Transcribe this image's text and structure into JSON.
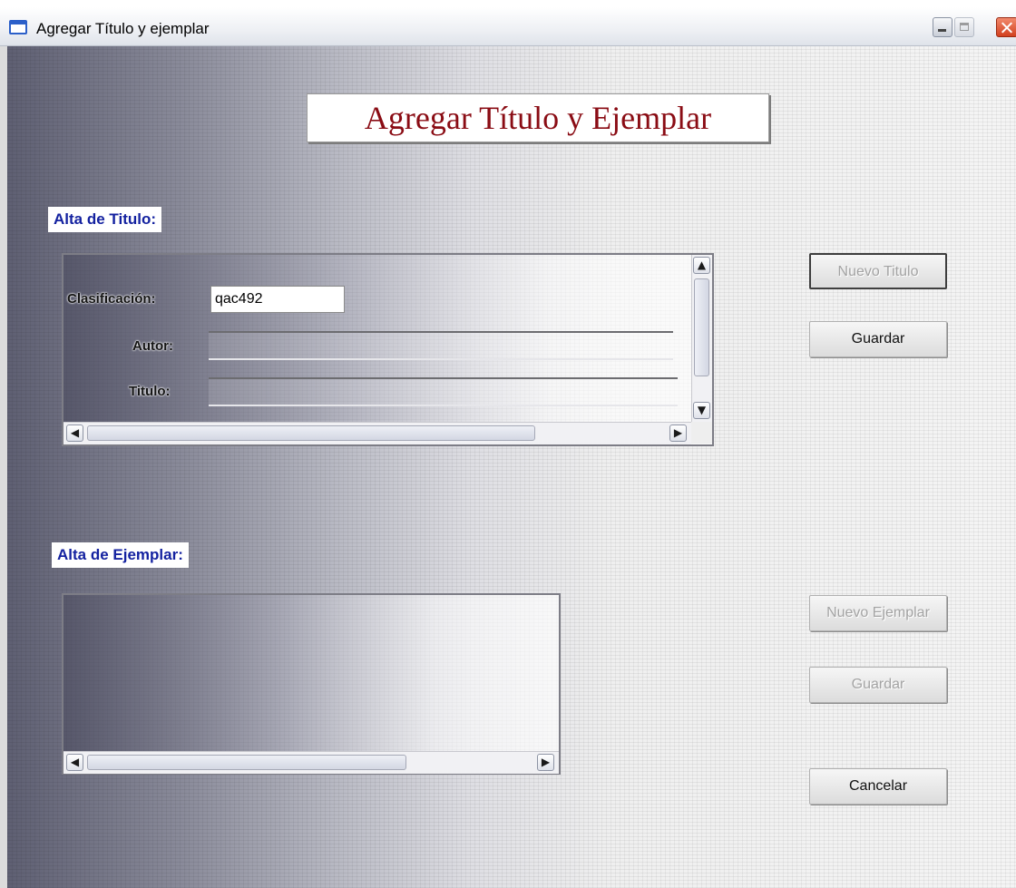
{
  "window": {
    "title": "Agregar Título y ejemplar"
  },
  "header": {
    "title": "Agregar Título y Ejemplar"
  },
  "alta_titulo": {
    "label": "Alta de Titulo:",
    "fields": {
      "clasificacion_label": "Clasificación:",
      "clasificacion_value": "qac492",
      "autor_label": "Autor:",
      "autor_value": "",
      "titulo_label": "Titulo:",
      "titulo_value": ""
    }
  },
  "alta_ejemplar": {
    "label": "Alta de Ejemplar:"
  },
  "buttons": {
    "nuevo_titulo": "Nuevo Titulo",
    "guardar_titulo": "Guardar",
    "nuevo_ejemplar": "Nuevo Ejemplar",
    "guardar_ejemplar": "Guardar",
    "cancelar": "Cancelar"
  },
  "button_states": {
    "nuevo_titulo": "disabled",
    "guardar_titulo": "enabled",
    "nuevo_ejemplar": "disabled",
    "guardar_ejemplar": "disabled",
    "cancelar": "enabled"
  },
  "icons": {
    "scroll_up": "▲",
    "scroll_down": "▼",
    "scroll_left": "◀",
    "scroll_right": "▶"
  },
  "colors": {
    "heading_text": "#8a0c14",
    "section_label_text": "#1422a0"
  }
}
